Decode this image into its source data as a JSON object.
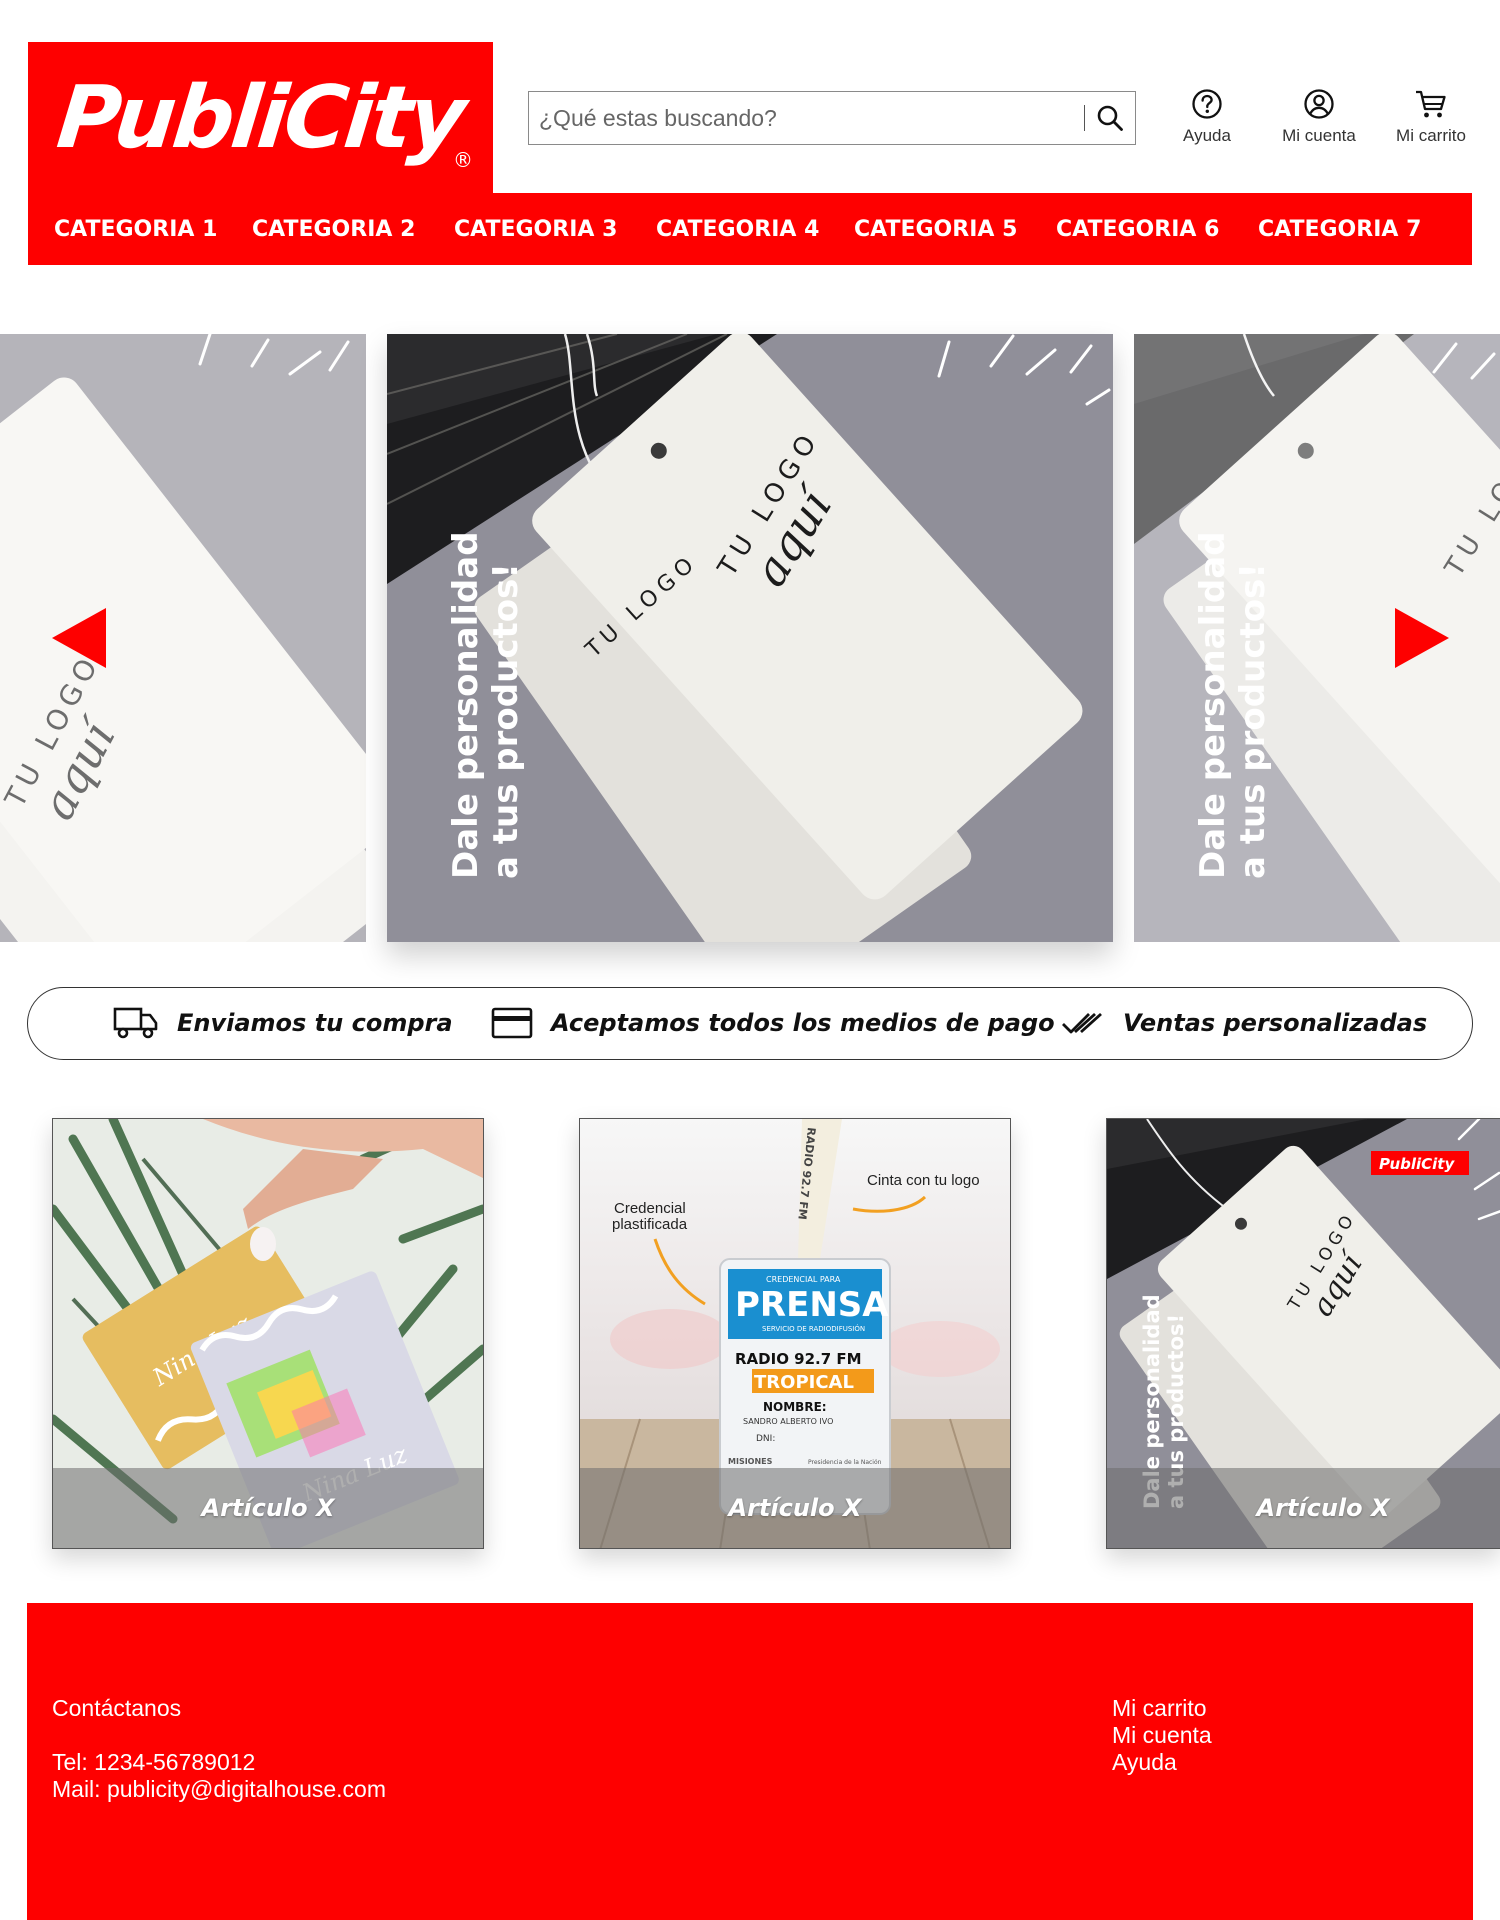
{
  "brand": {
    "logo_text": "PubliCity",
    "registered_mark": "®",
    "color": "#fe0000"
  },
  "search": {
    "placeholder": "¿Qué estas buscando?",
    "value": "",
    "icon": "search-icon"
  },
  "header_actions": [
    {
      "label": "Ayuda",
      "icon": "help-icon"
    },
    {
      "label": "Mi cuenta",
      "icon": "account-icon"
    },
    {
      "label": "Mi carrito",
      "icon": "cart-icon"
    }
  ],
  "nav": {
    "categories": [
      "CATEGORIA 1",
      "CATEGORIA 2",
      "CATEGORIA 3",
      "CATEGORIA 4",
      "CATEGORIA 5",
      "CATEGORIA 6",
      "CATEGORIA 7"
    ]
  },
  "carousel": {
    "slide_text_line1": "Dale personalidad",
    "slide_text_line2": "a tus productos!",
    "tag_text_small": "TU LOGO",
    "tag_text_script": "aquí",
    "prev_icon": "arrow-left-icon",
    "next_icon": "arrow-right-icon"
  },
  "features": [
    {
      "label": "Enviamos tu compra",
      "icon": "truck-icon"
    },
    {
      "label": "Aceptamos todos los medios de pago",
      "icon": "credit-card-icon"
    },
    {
      "label": "Ventas personalizadas",
      "icon": "double-check-icon"
    }
  ],
  "products": [
    {
      "caption": "Artículo X",
      "image": "hologram-tags-photo",
      "script_text": "Nina Luz"
    },
    {
      "caption": "Artículo X",
      "image": "press-credential-photo",
      "callout_ribbon": "Cinta con tu logo",
      "callout_credential_line1": "Credencial",
      "callout_credential_line2": "plastificada",
      "badge_small": "CREDENCIAL PARA",
      "badge_title": "PRENSA",
      "badge_sub": "SERVICIO DE RADIODIFUSIÓN",
      "badge_radio_line1": "RADIO 92.7 FM",
      "badge_radio_line2": "TROPICAL",
      "badge_name_label": "NOMBRE:",
      "badge_name_value": "SANDRO ALBERTO IVO",
      "badge_dni": "DNI:",
      "badge_org": "MISIONES",
      "badge_gov": "Presidencia de la Nación"
    },
    {
      "caption": "Artículo X",
      "image": "hang-tags-photo",
      "brand_badge": "PubliCity"
    }
  ],
  "footer": {
    "contact_title": "Contáctanos",
    "phone": "Tel: 1234-56789012",
    "mail": "Mail: publicity@digitalhouse.com",
    "links": [
      "Mi carrito",
      "Mi cuenta",
      "Ayuda"
    ]
  }
}
